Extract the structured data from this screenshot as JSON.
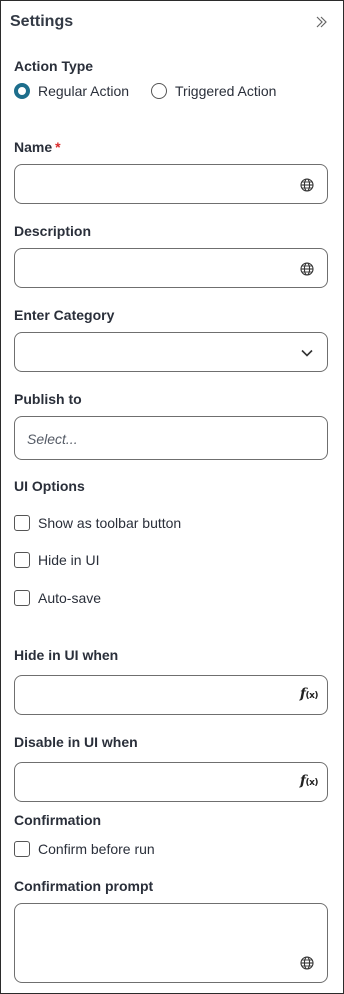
{
  "header": {
    "title": "Settings",
    "collapse_icon": "double-chevron-right-icon"
  },
  "action_type": {
    "label": "Action Type",
    "options": [
      {
        "label": "Regular Action",
        "selected": true
      },
      {
        "label": "Triggered Action",
        "selected": false
      }
    ]
  },
  "name": {
    "label": "Name",
    "required_mark": "*",
    "value": "",
    "icon": "globe-icon"
  },
  "description": {
    "label": "Description",
    "value": "",
    "icon": "globe-icon"
  },
  "category": {
    "label": "Enter Category",
    "value": "",
    "icon": "chevron-down-icon"
  },
  "publish_to": {
    "label": "Publish to",
    "placeholder": "Select..."
  },
  "ui_options": {
    "label": "UI Options",
    "checkboxes": [
      {
        "label": "Show as toolbar button",
        "checked": false
      },
      {
        "label": "Hide in UI",
        "checked": false
      },
      {
        "label": "Auto-save",
        "checked": false
      }
    ]
  },
  "hide_in_ui_when": {
    "label": "Hide in UI when",
    "value": "",
    "icon_text": "f",
    "icon_sub": "(x)"
  },
  "disable_in_ui_when": {
    "label": "Disable in UI when",
    "value": "",
    "icon_text": "f",
    "icon_sub": "(x)"
  },
  "confirmation": {
    "label": "Confirmation",
    "checkbox_label": "Confirm before run",
    "checked": false
  },
  "confirmation_prompt": {
    "label": "Confirmation prompt",
    "value": "",
    "icon": "globe-icon"
  },
  "colors": {
    "accent": "#1d6e8c",
    "required": "#d92b2b",
    "border": "#6f6f6f"
  }
}
